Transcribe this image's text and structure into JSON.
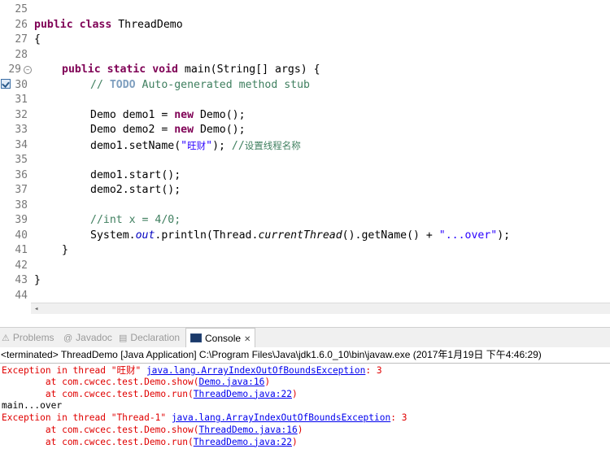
{
  "editor": {
    "line_numbers": [
      "25",
      "26",
      "27",
      "28",
      "29",
      "30",
      "31",
      "32",
      "33",
      "34",
      "35",
      "36",
      "37",
      "38",
      "39",
      "40",
      "41",
      "42",
      "43",
      "44"
    ],
    "l26": {
      "kw1": "public",
      "kw2": "class",
      "name": " ThreadDemo"
    },
    "l27": "{",
    "l29": {
      "kw1": "public",
      "kw2": "static",
      "kw3": "void",
      "rest": " main(String[] args) {"
    },
    "l30": {
      "prefix": "// ",
      "todo": "TODO",
      "rest": " Auto-generated method stub"
    },
    "l32": {
      "a": "Demo demo1 = ",
      "kw": "new",
      "b": " Demo();"
    },
    "l33": {
      "a": "Demo demo2 = ",
      "kw": "new",
      "b": " Demo();"
    },
    "l34": {
      "a": "demo1.setName(",
      "str_q1": "\"",
      "str_cjk": "旺财",
      "str_q2": "\"",
      "b": "); ",
      "cm": "//",
      "cm_cjk": "设置线程名称"
    },
    "l36": "demo1.start();",
    "l37": "demo2.start();",
    "l39": "//int x = 4/0;",
    "l40": {
      "a": "System.",
      "fld": "out",
      "b": ".println(Thread.",
      "ital": "currentThread",
      "c": "().getName() + ",
      "str": "\"...over\"",
      "d": ");"
    },
    "l41": "}",
    "l43": "}"
  },
  "tabs": {
    "problems": "Problems",
    "javadoc": "Javadoc",
    "declaration": "Declaration",
    "console": "Console"
  },
  "console": {
    "status": "<terminated> ThreadDemo [Java Application] C:\\Program Files\\Java\\jdk1.6.0_10\\bin\\javaw.exe (2017年1月19日 下午4:46:29)",
    "lines": {
      "e1_a": "Exception in thread \"",
      "e1_name": "旺财",
      "e1_b": "\" ",
      "e1_link": "java.lang.ArrayIndexOutOfBoundsException",
      "e1_c": ": 3",
      "s1_a": "        at com.cwcec.test.Demo.show(",
      "s1_link": "Demo.java:16",
      "s1_b": ")",
      "s2_a": "        at com.cwcec.test.Demo.run(",
      "s2_link": "ThreadDemo.java:22",
      "s2_b": ")",
      "main": "main...over",
      "e2_a": "Exception in thread \"Thread-1\" ",
      "e2_link": "java.lang.ArrayIndexOutOfBoundsException",
      "e2_c": ": 3",
      "s3_a": "        at com.cwcec.test.Demo.show(",
      "s3_link": "ThreadDemo.java:16",
      "s3_b": ")",
      "s4_a": "        at com.cwcec.test.Demo.run(",
      "s4_link": "ThreadDemo.java:22",
      "s4_b": ")"
    }
  },
  "colors": {
    "keyword": "#7f0055",
    "comment": "#3f7f5f",
    "string": "#2a00ff",
    "field": "#0000c0",
    "error": "#e00000",
    "link": "#0000ee"
  },
  "icons": [
    "fold-collapse-icon",
    "task-marker-icon",
    "scroll-left-arrow-icon",
    "problems-icon",
    "javadoc-icon",
    "declaration-icon",
    "console-icon",
    "close-icon"
  ]
}
